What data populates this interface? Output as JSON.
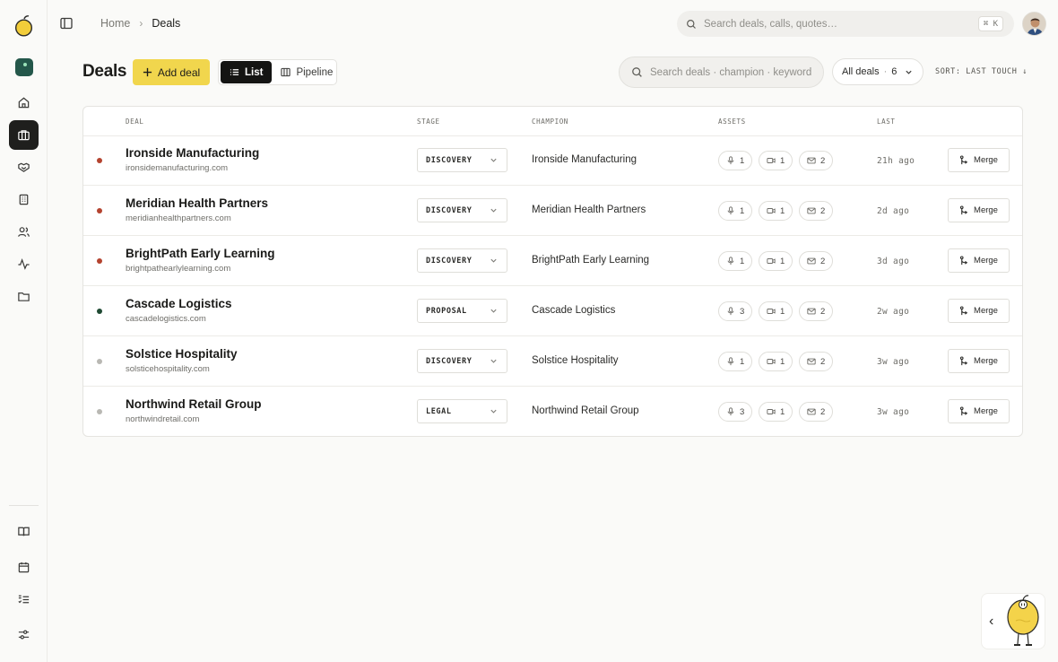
{
  "breadcrumb": {
    "home": "Home",
    "separator": "›",
    "current": "Deals"
  },
  "global_search": {
    "placeholder": "Search deals, calls, quotes…",
    "shortcut": "⌘ K"
  },
  "sidebar": {
    "top_items": [
      {
        "icon": "home-icon"
      },
      {
        "icon": "briefcase-icon",
        "active": true
      },
      {
        "icon": "handshake-icon"
      },
      {
        "icon": "building-icon"
      },
      {
        "icon": "users-icon"
      },
      {
        "icon": "activity-icon"
      },
      {
        "icon": "folder-icon"
      }
    ],
    "bottom_items": [
      {
        "icon": "book-icon"
      },
      {
        "icon": "calendar-icon"
      },
      {
        "icon": "checklist-icon"
      },
      {
        "icon": "sliders-icon"
      }
    ]
  },
  "page": {
    "title": "Deals",
    "add_label": "Add deal",
    "views": {
      "list": "List",
      "pipeline": "Pipeline",
      "active": "list"
    },
    "search_placeholder": "Search deals · champion · keyword",
    "filter": {
      "label": "All deals",
      "separator": "·",
      "count": "6"
    },
    "sort_label": "SORT: LAST TOUCH ↓"
  },
  "table": {
    "columns": {
      "deal": "DEAL",
      "stage": "STAGE",
      "champion": "CHAMPION",
      "assets": "ASSETS",
      "last": "LAST"
    },
    "merge_label": "Merge",
    "status_colors": {
      "red": "#b4432f",
      "green": "#1f4a33",
      "gray": "#b9b8b3"
    },
    "rows": [
      {
        "status": "red",
        "name": "Ironside Manufacturing",
        "domain": "ironsidemanufacturing.com",
        "stage": "DISCOVERY",
        "champion": "Ironside Manufacturing",
        "calls": "1",
        "videos": "1",
        "emails": "2",
        "last": "21h ago"
      },
      {
        "status": "red",
        "name": "Meridian Health Partners",
        "domain": "meridianhealthpartners.com",
        "stage": "DISCOVERY",
        "champion": "Meridian Health Partners",
        "calls": "1",
        "videos": "1",
        "emails": "2",
        "last": "2d ago"
      },
      {
        "status": "red",
        "name": "BrightPath Early Learning",
        "domain": "brightpathearlylearning.com",
        "stage": "DISCOVERY",
        "champion": "BrightPath Early Learning",
        "calls": "1",
        "videos": "1",
        "emails": "2",
        "last": "3d ago"
      },
      {
        "status": "green",
        "name": "Cascade Logistics",
        "domain": "cascadelogistics.com",
        "stage": "PROPOSAL",
        "champion": "Cascade Logistics",
        "calls": "3",
        "videos": "1",
        "emails": "2",
        "last": "2w ago"
      },
      {
        "status": "gray",
        "name": "Solstice Hospitality",
        "domain": "solsticehospitality.com",
        "stage": "DISCOVERY",
        "champion": "Solstice Hospitality",
        "calls": "1",
        "videos": "1",
        "emails": "2",
        "last": "3w ago"
      },
      {
        "status": "gray",
        "name": "Northwind Retail Group",
        "domain": "northwindretail.com",
        "stage": "LEGAL",
        "champion": "Northwind Retail Group",
        "calls": "3",
        "videos": "1",
        "emails": "2",
        "last": "3w ago"
      }
    ]
  },
  "widget": {
    "collapse": "‹"
  },
  "colors": {
    "accent": "#f1d64d",
    "sidebar_active": "#1f1f1d",
    "view_active": "#141413"
  }
}
